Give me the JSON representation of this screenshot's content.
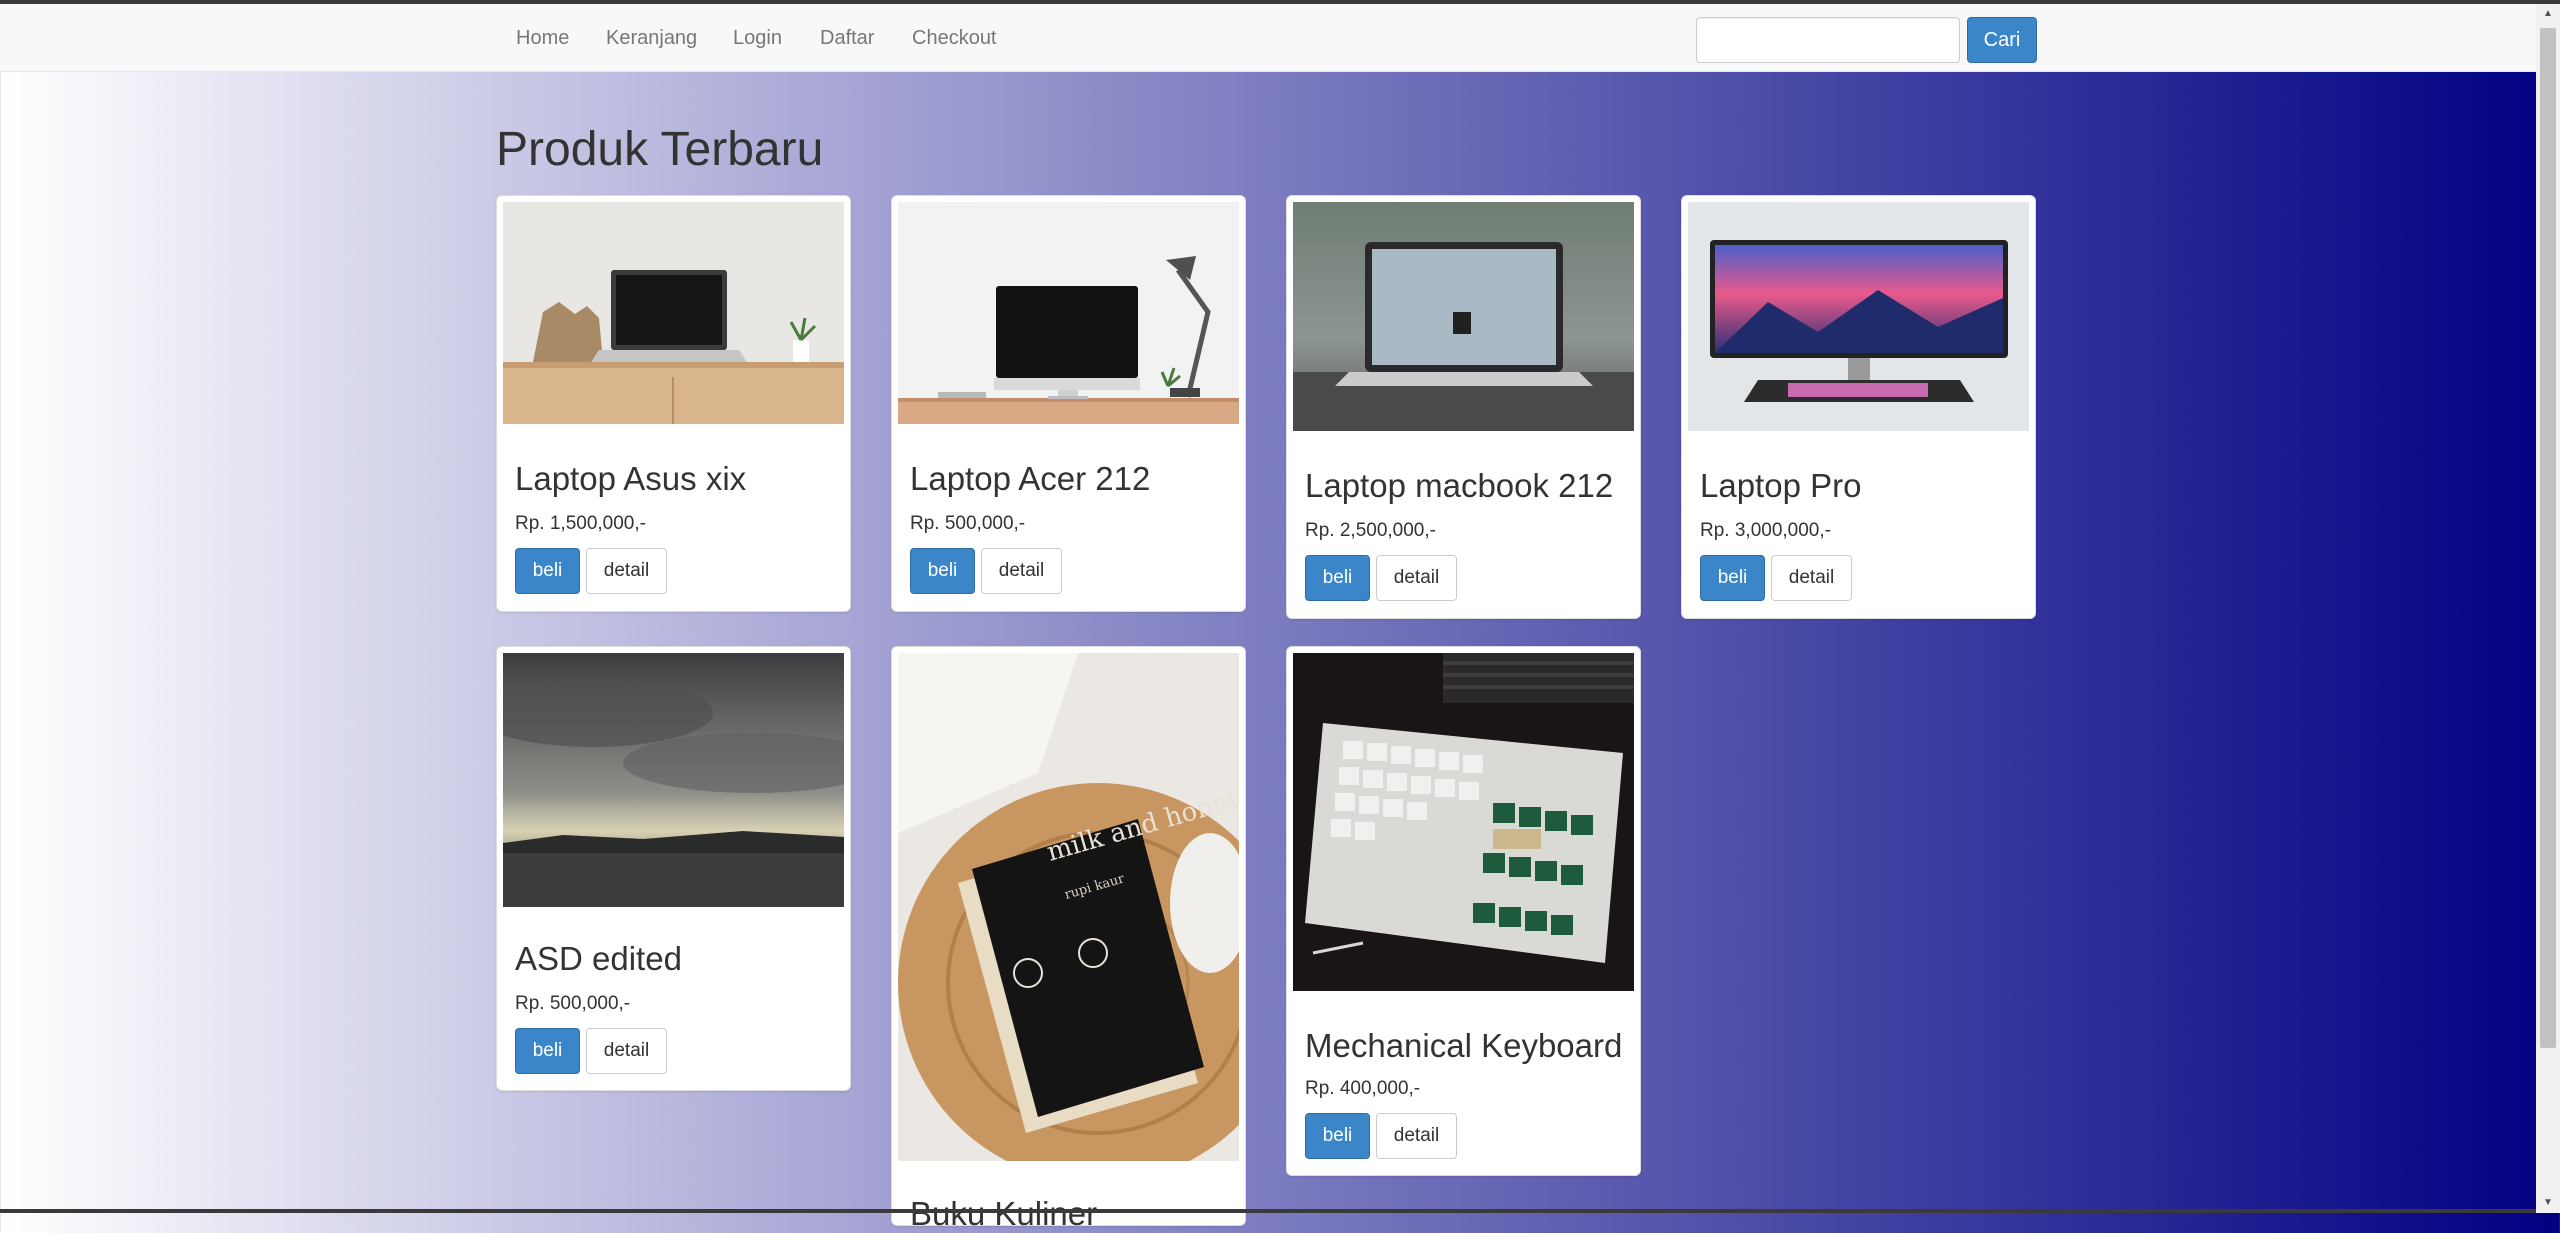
{
  "nav": {
    "links": [
      "Home",
      "Keranjang",
      "Login",
      "Daftar",
      "Checkout"
    ],
    "search_placeholder": "",
    "search_button": "Cari"
  },
  "page": {
    "title": "Produk Terbaru"
  },
  "products": [
    {
      "name": "Laptop Asus xix",
      "price": "Rp. 1,500,000,-",
      "buy_label": "beli",
      "detail_label": "detail"
    },
    {
      "name": "Laptop Acer 212",
      "price": "Rp. 500,000,-",
      "buy_label": "beli",
      "detail_label": "detail"
    },
    {
      "name": "Laptop macbook 212",
      "price": "Rp. 2,500,000,-",
      "buy_label": "beli",
      "detail_label": "detail"
    },
    {
      "name": "Laptop Pro",
      "price": "Rp. 3,000,000,-",
      "buy_label": "beli",
      "detail_label": "detail"
    },
    {
      "name": "ASD edited",
      "price": "Rp. 500,000,-",
      "buy_label": "beli",
      "detail_label": "detail"
    },
    {
      "name": "Buku Kuliner",
      "book_title": "milk and honey",
      "book_author": "rupi kaur"
    },
    {
      "name": "Mechanical Keyboard",
      "price": "Rp. 400,000,-",
      "buy_label": "beli",
      "detail_label": "detail"
    }
  ],
  "colors": {
    "primary_button": "#3a86c9",
    "gradient_end": "#000082"
  }
}
